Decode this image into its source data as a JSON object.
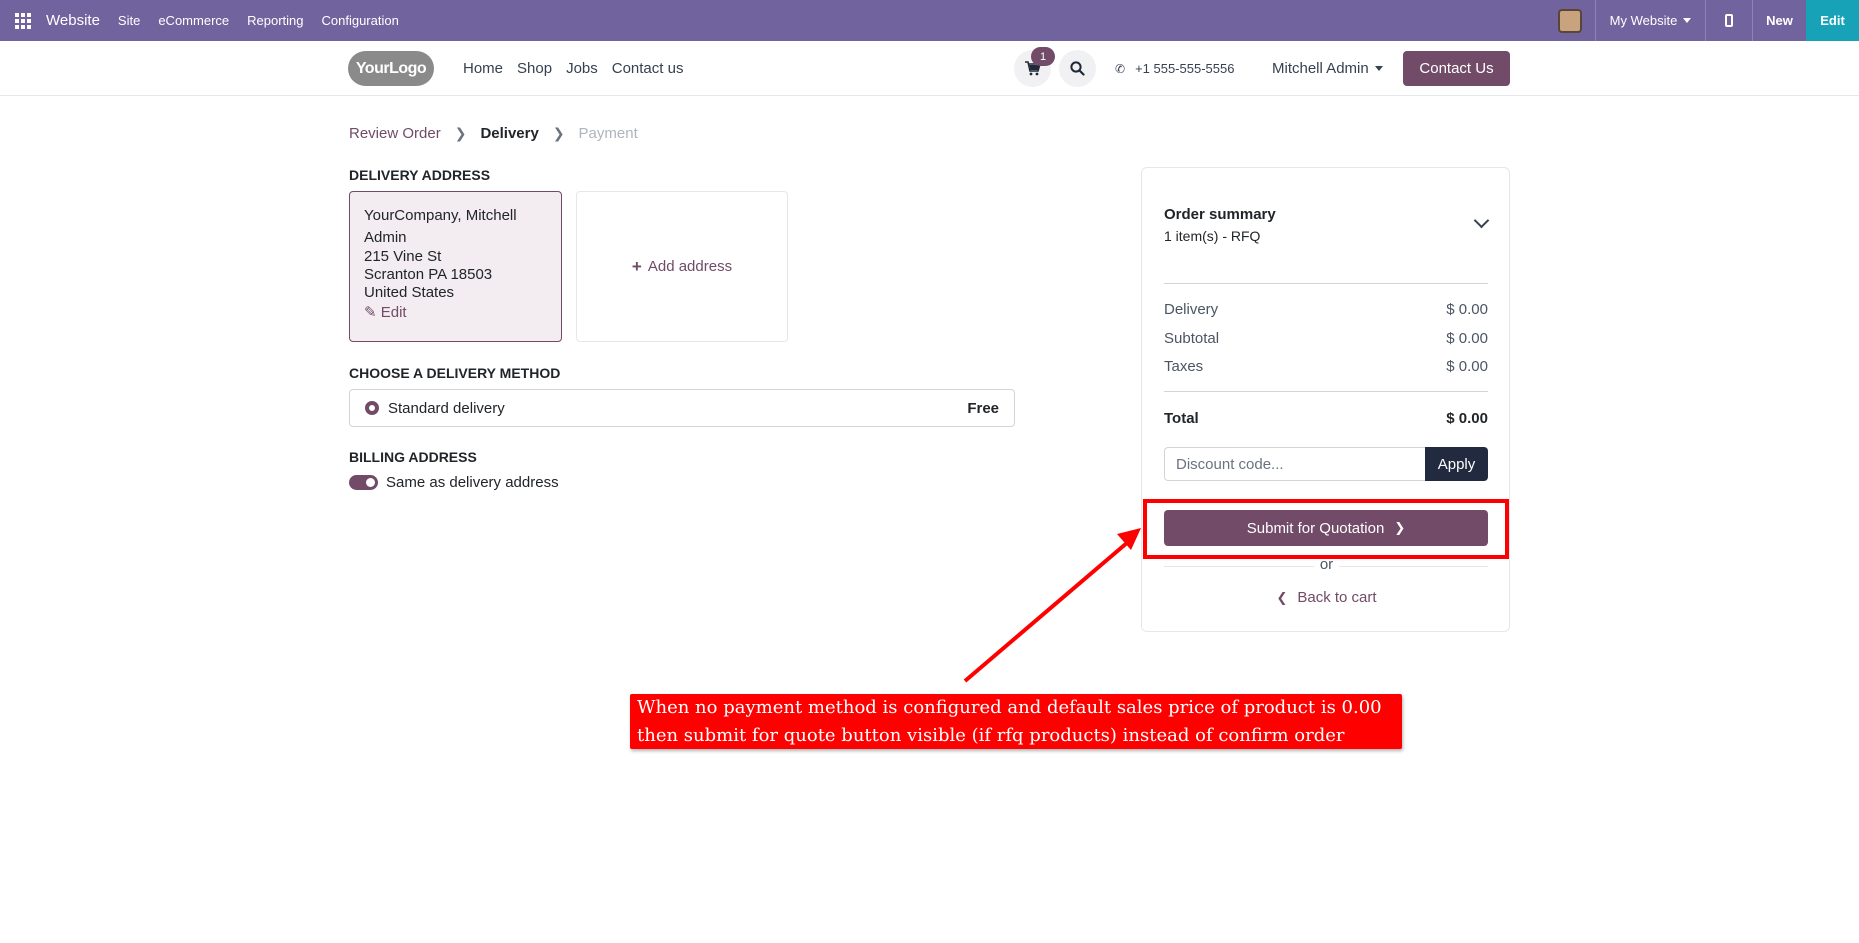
{
  "admin_bar": {
    "app_name": "Website",
    "menu": [
      "Site",
      "eCommerce",
      "Reporting",
      "Configuration"
    ],
    "website_selector": "My Website",
    "new_label": "New",
    "edit_label": "Edit",
    "color": "#71639e",
    "edit_color": "#17a2b8"
  },
  "header": {
    "logo_text": "YourLogo",
    "nav": [
      "Home",
      "Shop",
      "Jobs",
      "Contact us"
    ],
    "cart_count": "1",
    "phone": "+1 555-555-5556",
    "user": "Mitchell Admin",
    "contact_button": "Contact Us",
    "brand_color": "#714b67"
  },
  "steps": {
    "review": "Review Order",
    "delivery": "Delivery",
    "payment": "Payment"
  },
  "delivery_address": {
    "title": "DELIVERY ADDRESS",
    "name_line1": "YourCompany, Mitchell",
    "name_line2": "Admin",
    "street": "215 Vine St",
    "city": "Scranton PA 18503",
    "country": "United States",
    "edit_label": "Edit",
    "add_label": "Add address"
  },
  "delivery_method": {
    "title": "CHOOSE A DELIVERY METHOD",
    "option": "Standard delivery",
    "price": "Free"
  },
  "billing": {
    "title": "BILLING ADDRESS",
    "toggle_label": "Same as delivery address",
    "toggle_on": true
  },
  "summary": {
    "title": "Order summary",
    "subtitle": "1 item(s) -  RFQ",
    "rows": [
      {
        "label": "Delivery",
        "value": "$ 0.00"
      },
      {
        "label": "Subtotal",
        "value": "$ 0.00"
      },
      {
        "label": "Taxes",
        "value": "$ 0.00"
      }
    ],
    "total_label": "Total",
    "total_value": "$ 0.00",
    "discount_placeholder": "Discount code...",
    "apply_label": "Apply",
    "submit_label": "Submit for Quotation",
    "or_label": "or",
    "back_label": "Back to cart"
  },
  "annotation": {
    "line1": "When no payment method is configured and default sales price of product is 0.00",
    "line2": "then submit for quote button visible (if rfq products) instead of  confirm order",
    "color": "#ff0000"
  }
}
